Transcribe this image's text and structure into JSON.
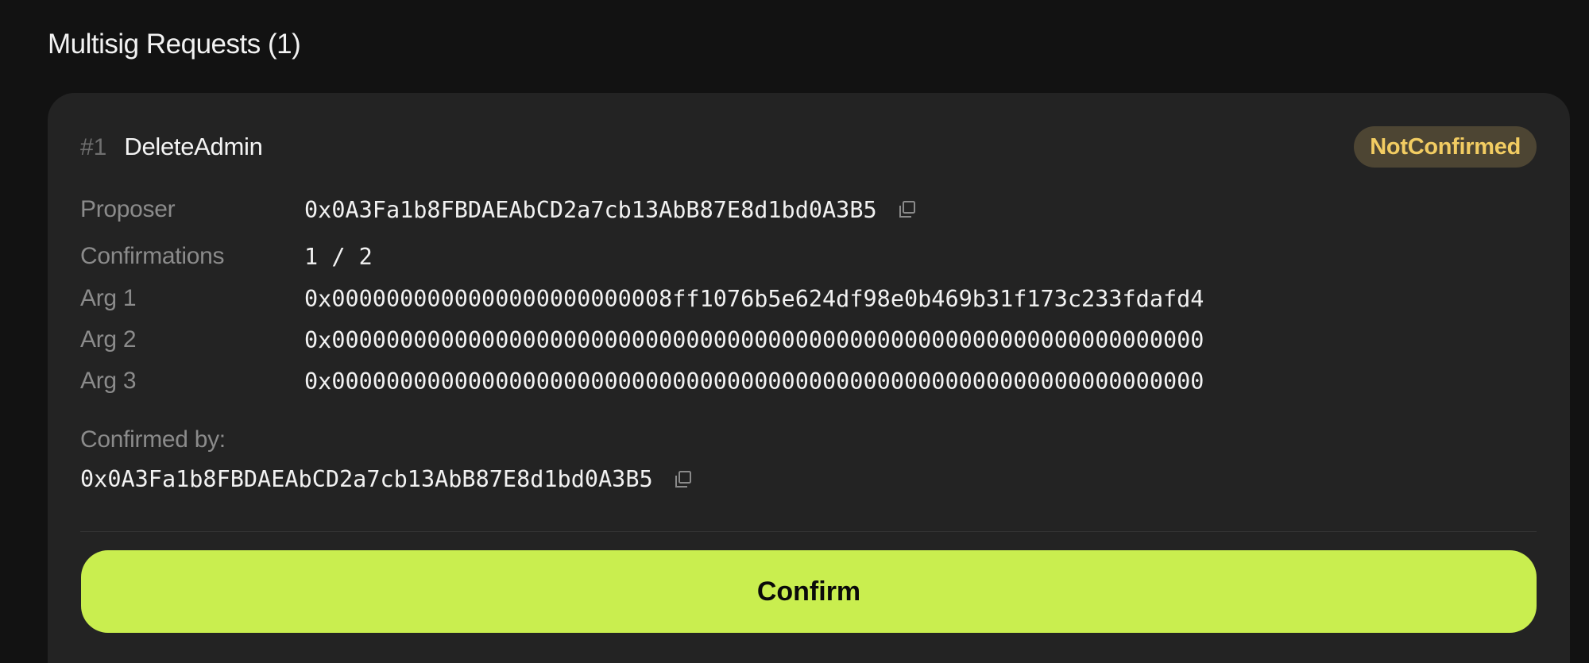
{
  "section": {
    "title": "Multisig Requests (1)"
  },
  "request": {
    "number": "#1",
    "type": "DeleteAdmin",
    "status": "NotConfirmed",
    "fields": [
      {
        "label": "Proposer",
        "value": "0x0A3Fa1b8FBDAEAbCD2a7cb13AbB87E8d1bd0A3B5",
        "icon": "copy-icon"
      },
      {
        "label": "Confirmations",
        "value": "1 / 2"
      },
      {
        "label": "Arg 1",
        "value": "0x0000000000000000000000008ff1076b5e624df98e0b469b31f173c233fdafd4"
      },
      {
        "label": "Arg 2",
        "value": "0x0000000000000000000000000000000000000000000000000000000000000000"
      },
      {
        "label": "Arg 3",
        "value": "0x0000000000000000000000000000000000000000000000000000000000000000"
      }
    ],
    "confirmed_by_label": "Confirmed by:",
    "confirmed_by": [
      {
        "address": "0x0A3Fa1b8FBDAEAbCD2a7cb13AbB87E8d1bd0A3B5",
        "icon": "copy-icon"
      }
    ],
    "confirm_button_label": "Confirm"
  },
  "colors": {
    "background": "#121212",
    "card": "#232323",
    "accent": "#c9ee4f",
    "status_badge_bg": "#4d4533",
    "status_badge_text": "#f2cc62"
  }
}
